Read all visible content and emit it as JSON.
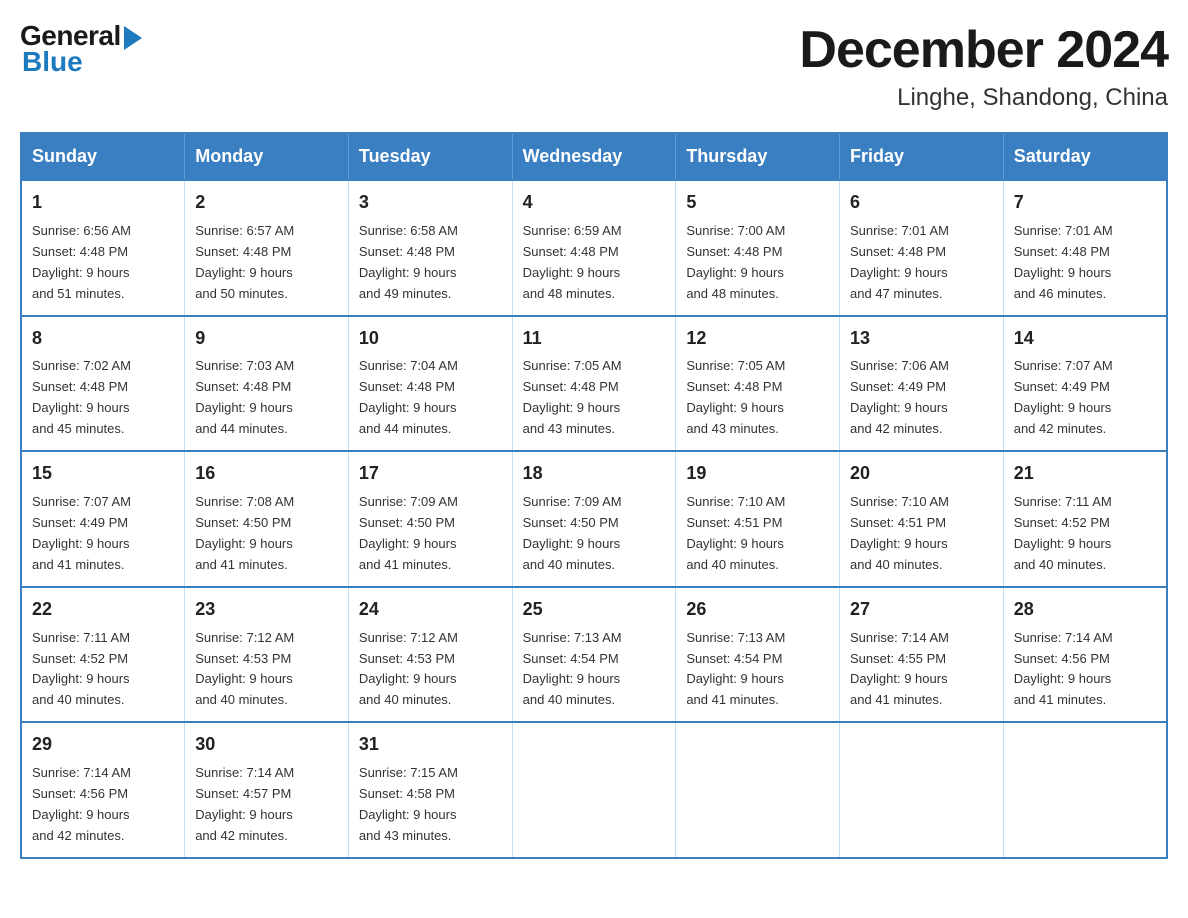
{
  "header": {
    "logo_general": "General",
    "logo_blue": "Blue",
    "month_title": "December 2024",
    "location": "Linghe, Shandong, China"
  },
  "calendar": {
    "days_of_week": [
      "Sunday",
      "Monday",
      "Tuesday",
      "Wednesday",
      "Thursday",
      "Friday",
      "Saturday"
    ],
    "weeks": [
      [
        {
          "day": "1",
          "sunrise": "6:56 AM",
          "sunset": "4:48 PM",
          "daylight": "9 hours and 51 minutes."
        },
        {
          "day": "2",
          "sunrise": "6:57 AM",
          "sunset": "4:48 PM",
          "daylight": "9 hours and 50 minutes."
        },
        {
          "day": "3",
          "sunrise": "6:58 AM",
          "sunset": "4:48 PM",
          "daylight": "9 hours and 49 minutes."
        },
        {
          "day": "4",
          "sunrise": "6:59 AM",
          "sunset": "4:48 PM",
          "daylight": "9 hours and 48 minutes."
        },
        {
          "day": "5",
          "sunrise": "7:00 AM",
          "sunset": "4:48 PM",
          "daylight": "9 hours and 48 minutes."
        },
        {
          "day": "6",
          "sunrise": "7:01 AM",
          "sunset": "4:48 PM",
          "daylight": "9 hours and 47 minutes."
        },
        {
          "day": "7",
          "sunrise": "7:01 AM",
          "sunset": "4:48 PM",
          "daylight": "9 hours and 46 minutes."
        }
      ],
      [
        {
          "day": "8",
          "sunrise": "7:02 AM",
          "sunset": "4:48 PM",
          "daylight": "9 hours and 45 minutes."
        },
        {
          "day": "9",
          "sunrise": "7:03 AM",
          "sunset": "4:48 PM",
          "daylight": "9 hours and 44 minutes."
        },
        {
          "day": "10",
          "sunrise": "7:04 AM",
          "sunset": "4:48 PM",
          "daylight": "9 hours and 44 minutes."
        },
        {
          "day": "11",
          "sunrise": "7:05 AM",
          "sunset": "4:48 PM",
          "daylight": "9 hours and 43 minutes."
        },
        {
          "day": "12",
          "sunrise": "7:05 AM",
          "sunset": "4:48 PM",
          "daylight": "9 hours and 43 minutes."
        },
        {
          "day": "13",
          "sunrise": "7:06 AM",
          "sunset": "4:49 PM",
          "daylight": "9 hours and 42 minutes."
        },
        {
          "day": "14",
          "sunrise": "7:07 AM",
          "sunset": "4:49 PM",
          "daylight": "9 hours and 42 minutes."
        }
      ],
      [
        {
          "day": "15",
          "sunrise": "7:07 AM",
          "sunset": "4:49 PM",
          "daylight": "9 hours and 41 minutes."
        },
        {
          "day": "16",
          "sunrise": "7:08 AM",
          "sunset": "4:50 PM",
          "daylight": "9 hours and 41 minutes."
        },
        {
          "day": "17",
          "sunrise": "7:09 AM",
          "sunset": "4:50 PM",
          "daylight": "9 hours and 41 minutes."
        },
        {
          "day": "18",
          "sunrise": "7:09 AM",
          "sunset": "4:50 PM",
          "daylight": "9 hours and 40 minutes."
        },
        {
          "day": "19",
          "sunrise": "7:10 AM",
          "sunset": "4:51 PM",
          "daylight": "9 hours and 40 minutes."
        },
        {
          "day": "20",
          "sunrise": "7:10 AM",
          "sunset": "4:51 PM",
          "daylight": "9 hours and 40 minutes."
        },
        {
          "day": "21",
          "sunrise": "7:11 AM",
          "sunset": "4:52 PM",
          "daylight": "9 hours and 40 minutes."
        }
      ],
      [
        {
          "day": "22",
          "sunrise": "7:11 AM",
          "sunset": "4:52 PM",
          "daylight": "9 hours and 40 minutes."
        },
        {
          "day": "23",
          "sunrise": "7:12 AM",
          "sunset": "4:53 PM",
          "daylight": "9 hours and 40 minutes."
        },
        {
          "day": "24",
          "sunrise": "7:12 AM",
          "sunset": "4:53 PM",
          "daylight": "9 hours and 40 minutes."
        },
        {
          "day": "25",
          "sunrise": "7:13 AM",
          "sunset": "4:54 PM",
          "daylight": "9 hours and 40 minutes."
        },
        {
          "day": "26",
          "sunrise": "7:13 AM",
          "sunset": "4:54 PM",
          "daylight": "9 hours and 41 minutes."
        },
        {
          "day": "27",
          "sunrise": "7:14 AM",
          "sunset": "4:55 PM",
          "daylight": "9 hours and 41 minutes."
        },
        {
          "day": "28",
          "sunrise": "7:14 AM",
          "sunset": "4:56 PM",
          "daylight": "9 hours and 41 minutes."
        }
      ],
      [
        {
          "day": "29",
          "sunrise": "7:14 AM",
          "sunset": "4:56 PM",
          "daylight": "9 hours and 42 minutes."
        },
        {
          "day": "30",
          "sunrise": "7:14 AM",
          "sunset": "4:57 PM",
          "daylight": "9 hours and 42 minutes."
        },
        {
          "day": "31",
          "sunrise": "7:15 AM",
          "sunset": "4:58 PM",
          "daylight": "9 hours and 43 minutes."
        },
        null,
        null,
        null,
        null
      ]
    ],
    "labels": {
      "sunrise": "Sunrise:",
      "sunset": "Sunset:",
      "daylight": "Daylight:"
    }
  }
}
